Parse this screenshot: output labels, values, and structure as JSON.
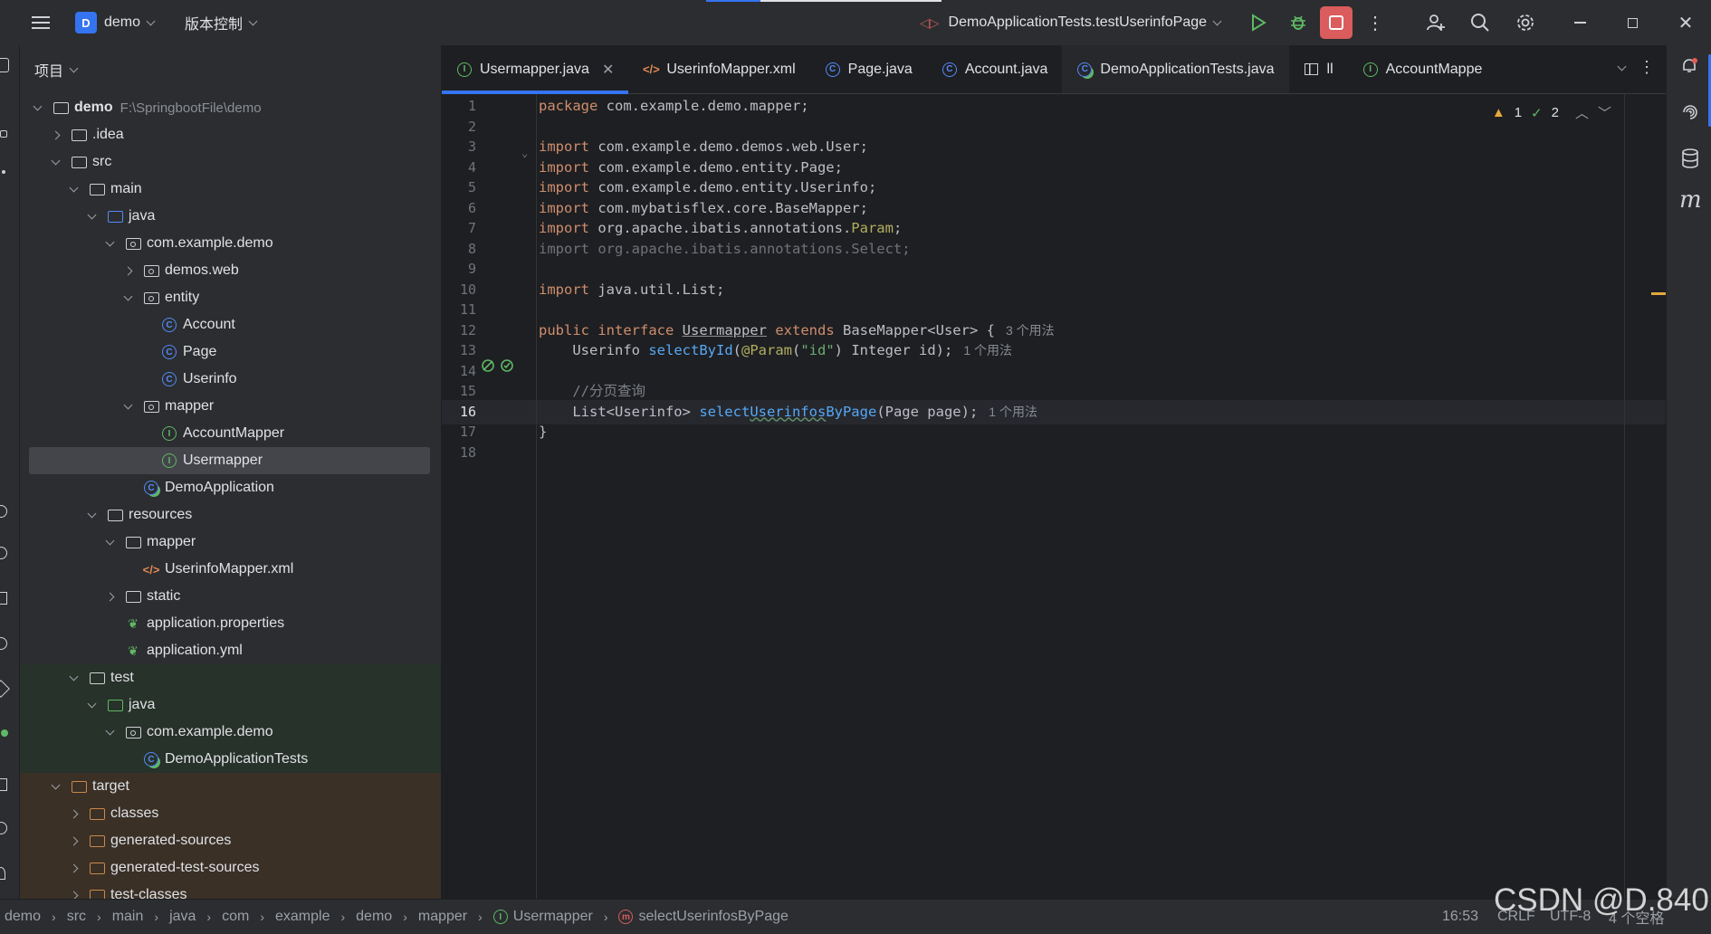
{
  "topbar": {
    "project_badge": "D",
    "project_name": "demo",
    "vcs_label": "版本控制",
    "run_config": "DemoApplicationTests.testUserinfoPage"
  },
  "project_panel": {
    "title": "项目",
    "tree": [
      {
        "label": "demo",
        "path": "F:\\SpringbootFile\\demo",
        "depth": 0,
        "arrow": "down",
        "icon": "folder",
        "bold": true
      },
      {
        "label": ".idea",
        "depth": 1,
        "arrow": "right",
        "icon": "folder"
      },
      {
        "label": "src",
        "depth": 1,
        "arrow": "down",
        "icon": "folder"
      },
      {
        "label": "main",
        "depth": 2,
        "arrow": "down",
        "icon": "folder"
      },
      {
        "label": "java",
        "depth": 3,
        "arrow": "down",
        "icon": "folder-blue"
      },
      {
        "label": "com.example.demo",
        "depth": 4,
        "arrow": "down",
        "icon": "package"
      },
      {
        "label": "demos.web",
        "depth": 5,
        "arrow": "right",
        "icon": "package"
      },
      {
        "label": "entity",
        "depth": 5,
        "arrow": "down",
        "icon": "package"
      },
      {
        "label": "Account",
        "depth": 6,
        "arrow": "none",
        "icon": "class"
      },
      {
        "label": "Page",
        "depth": 6,
        "arrow": "none",
        "icon": "class"
      },
      {
        "label": "Userinfo",
        "depth": 6,
        "arrow": "none",
        "icon": "class"
      },
      {
        "label": "mapper",
        "depth": 5,
        "arrow": "down",
        "icon": "package"
      },
      {
        "label": "AccountMapper",
        "depth": 6,
        "arrow": "none",
        "icon": "interface"
      },
      {
        "label": "Usermapper",
        "depth": 6,
        "arrow": "none",
        "icon": "interface",
        "selected": true
      },
      {
        "label": "DemoApplication",
        "depth": 5,
        "arrow": "none",
        "icon": "spring-class"
      },
      {
        "label": "resources",
        "depth": 3,
        "arrow": "down",
        "icon": "folder-res"
      },
      {
        "label": "mapper",
        "depth": 4,
        "arrow": "down",
        "icon": "folder"
      },
      {
        "label": "UserinfoMapper.xml",
        "depth": 5,
        "arrow": "none",
        "icon": "xml"
      },
      {
        "label": "static",
        "depth": 4,
        "arrow": "right",
        "icon": "folder"
      },
      {
        "label": "application.properties",
        "depth": 4,
        "arrow": "none",
        "icon": "spring-config"
      },
      {
        "label": "application.yml",
        "depth": 4,
        "arrow": "none",
        "icon": "spring-config"
      },
      {
        "label": "test",
        "depth": 2,
        "arrow": "down",
        "icon": "folder",
        "tint": "green"
      },
      {
        "label": "java",
        "depth": 3,
        "arrow": "down",
        "icon": "folder-green",
        "tint": "green"
      },
      {
        "label": "com.example.demo",
        "depth": 4,
        "arrow": "down",
        "icon": "package",
        "tint": "green"
      },
      {
        "label": "DemoApplicationTests",
        "depth": 5,
        "arrow": "none",
        "icon": "spring-class",
        "tint": "green"
      },
      {
        "label": "target",
        "depth": 1,
        "arrow": "down",
        "icon": "folder-orange",
        "tint": "orange"
      },
      {
        "label": "classes",
        "depth": 2,
        "arrow": "right",
        "icon": "folder-orange",
        "tint": "orange"
      },
      {
        "label": "generated-sources",
        "depth": 2,
        "arrow": "right",
        "icon": "folder-orange",
        "tint": "orange"
      },
      {
        "label": "generated-test-sources",
        "depth": 2,
        "arrow": "right",
        "icon": "folder-orange",
        "tint": "orange"
      },
      {
        "label": "test-classes",
        "depth": 2,
        "arrow": "right",
        "icon": "folder-orange",
        "tint": "orange"
      }
    ]
  },
  "tabs": [
    {
      "label": "Usermapper.java",
      "icon": "interface",
      "active": true,
      "closable": true
    },
    {
      "label": "UserinfoMapper.xml",
      "icon": "xml"
    },
    {
      "label": "Page.java",
      "icon": "class"
    },
    {
      "label": "Account.java",
      "icon": "class"
    },
    {
      "label": "DemoApplicationTests.java",
      "icon": "spring-class",
      "dim": true
    },
    {
      "label": "ll",
      "icon": "table"
    },
    {
      "label": "AccountMappe",
      "icon": "interface"
    }
  ],
  "inspections": {
    "warnings": "1",
    "weak_warnings": "2"
  },
  "editor": {
    "current_line": 16,
    "lines": [
      {
        "n": "1",
        "html": "<span class=\"kw\">package</span> com.example.demo.mapper;"
      },
      {
        "n": "2",
        "html": ""
      },
      {
        "n": "3",
        "html": "<span class=\"kw\">import</span> com.example.demo.demos.web.User;"
      },
      {
        "n": "4",
        "html": "<span class=\"kw\">import</span> com.example.demo.entity.Page;"
      },
      {
        "n": "5",
        "html": "<span class=\"kw\">import</span> com.example.demo.entity.Userinfo;"
      },
      {
        "n": "6",
        "html": "<span class=\"kw\">import</span> com.mybatisflex.core.BaseMapper;"
      },
      {
        "n": "7",
        "html": "<span class=\"kw\">import</span> org.apache.ibatis.annotations.<span class=\"ann\">Param</span>;"
      },
      {
        "n": "8",
        "html": "<span class=\"unused\">import org.apache.ibatis.annotations.Select;</span>"
      },
      {
        "n": "9",
        "html": ""
      },
      {
        "n": "10",
        "html": "<span class=\"kw\">import</span> java.util.List;"
      },
      {
        "n": "11",
        "html": ""
      },
      {
        "n": "12",
        "html": "<span class=\"kw\">public interface</span> <span class=\"underline\">Usermapper</span> <span class=\"kw\">extends</span> BaseMapper&lt;User&gt; {<span class=\"hint\">3 个用法</span>"
      },
      {
        "n": "13",
        "html": "    Userinfo <span class=\"fn\">selectById</span>(<span class=\"ann\">@Param</span>(<span class=\"str\">\"id\"</span>) Integer id);<span class=\"hint\">1 个用法</span>"
      },
      {
        "n": "14",
        "html": ""
      },
      {
        "n": "15",
        "html": "    <span class=\"cmt\">//分页查询</span>"
      },
      {
        "n": "16",
        "html": "    List&lt;Userinfo&gt; <span class=\"fn\">select<span class=\"wavy\">Userinfos</span>ByPage</span>(Page page);<span class=\"hint\">1 个用法</span>"
      },
      {
        "n": "17",
        "html": "}"
      },
      {
        "n": "18",
        "html": ""
      }
    ]
  },
  "breadcrumbs": [
    "demo",
    "src",
    "main",
    "java",
    "com",
    "example",
    "demo",
    "mapper",
    "Usermapper",
    "selectUserinfosByPage"
  ],
  "status": {
    "position": "16:53",
    "line_sep": "CRLF",
    "encoding": "UTF-8",
    "indent": "4 个空格"
  },
  "watermark": "CSDN @D.840"
}
